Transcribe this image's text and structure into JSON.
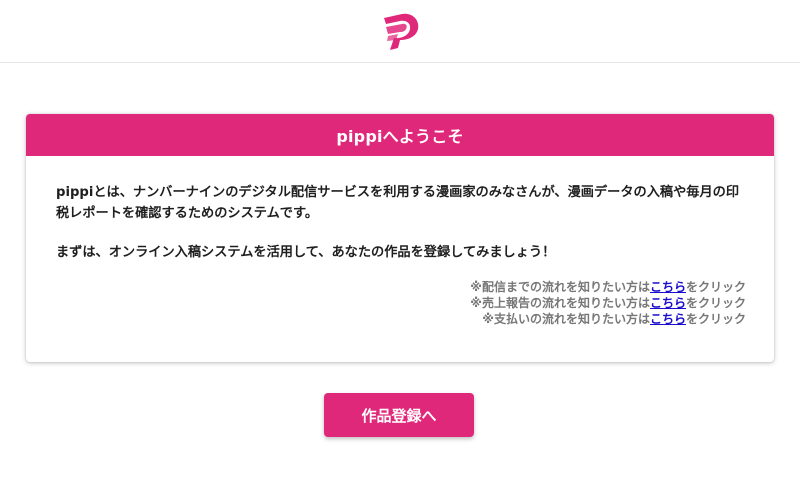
{
  "header": {
    "logo_icon": "pippi-logo-icon",
    "brand_color": "#e0287a"
  },
  "welcome_card": {
    "title": "pippiへようこそ",
    "paragraph1": "pippiとは、ナンバーナインのデジタル配信サービスを利用する漫画家のみなさんが、漫画データの入稿や毎月の印税レポートを確認するためのシステムです。",
    "paragraph2": "まずは、オンライン入稿システムを活用して、あなたの作品を登録してみましょう！",
    "notes": [
      {
        "prefix": "※配信までの流れを知りたい方は",
        "link": "こちら",
        "suffix": "をクリック"
      },
      {
        "prefix": "※売上報告の流れを知りたい方は",
        "link": "こちら",
        "suffix": "をクリック"
      },
      {
        "prefix": "※支払いの流れを知りたい方は",
        "link": "こちら",
        "suffix": "をクリック"
      }
    ]
  },
  "register_button": {
    "label": "作品登録へ"
  }
}
